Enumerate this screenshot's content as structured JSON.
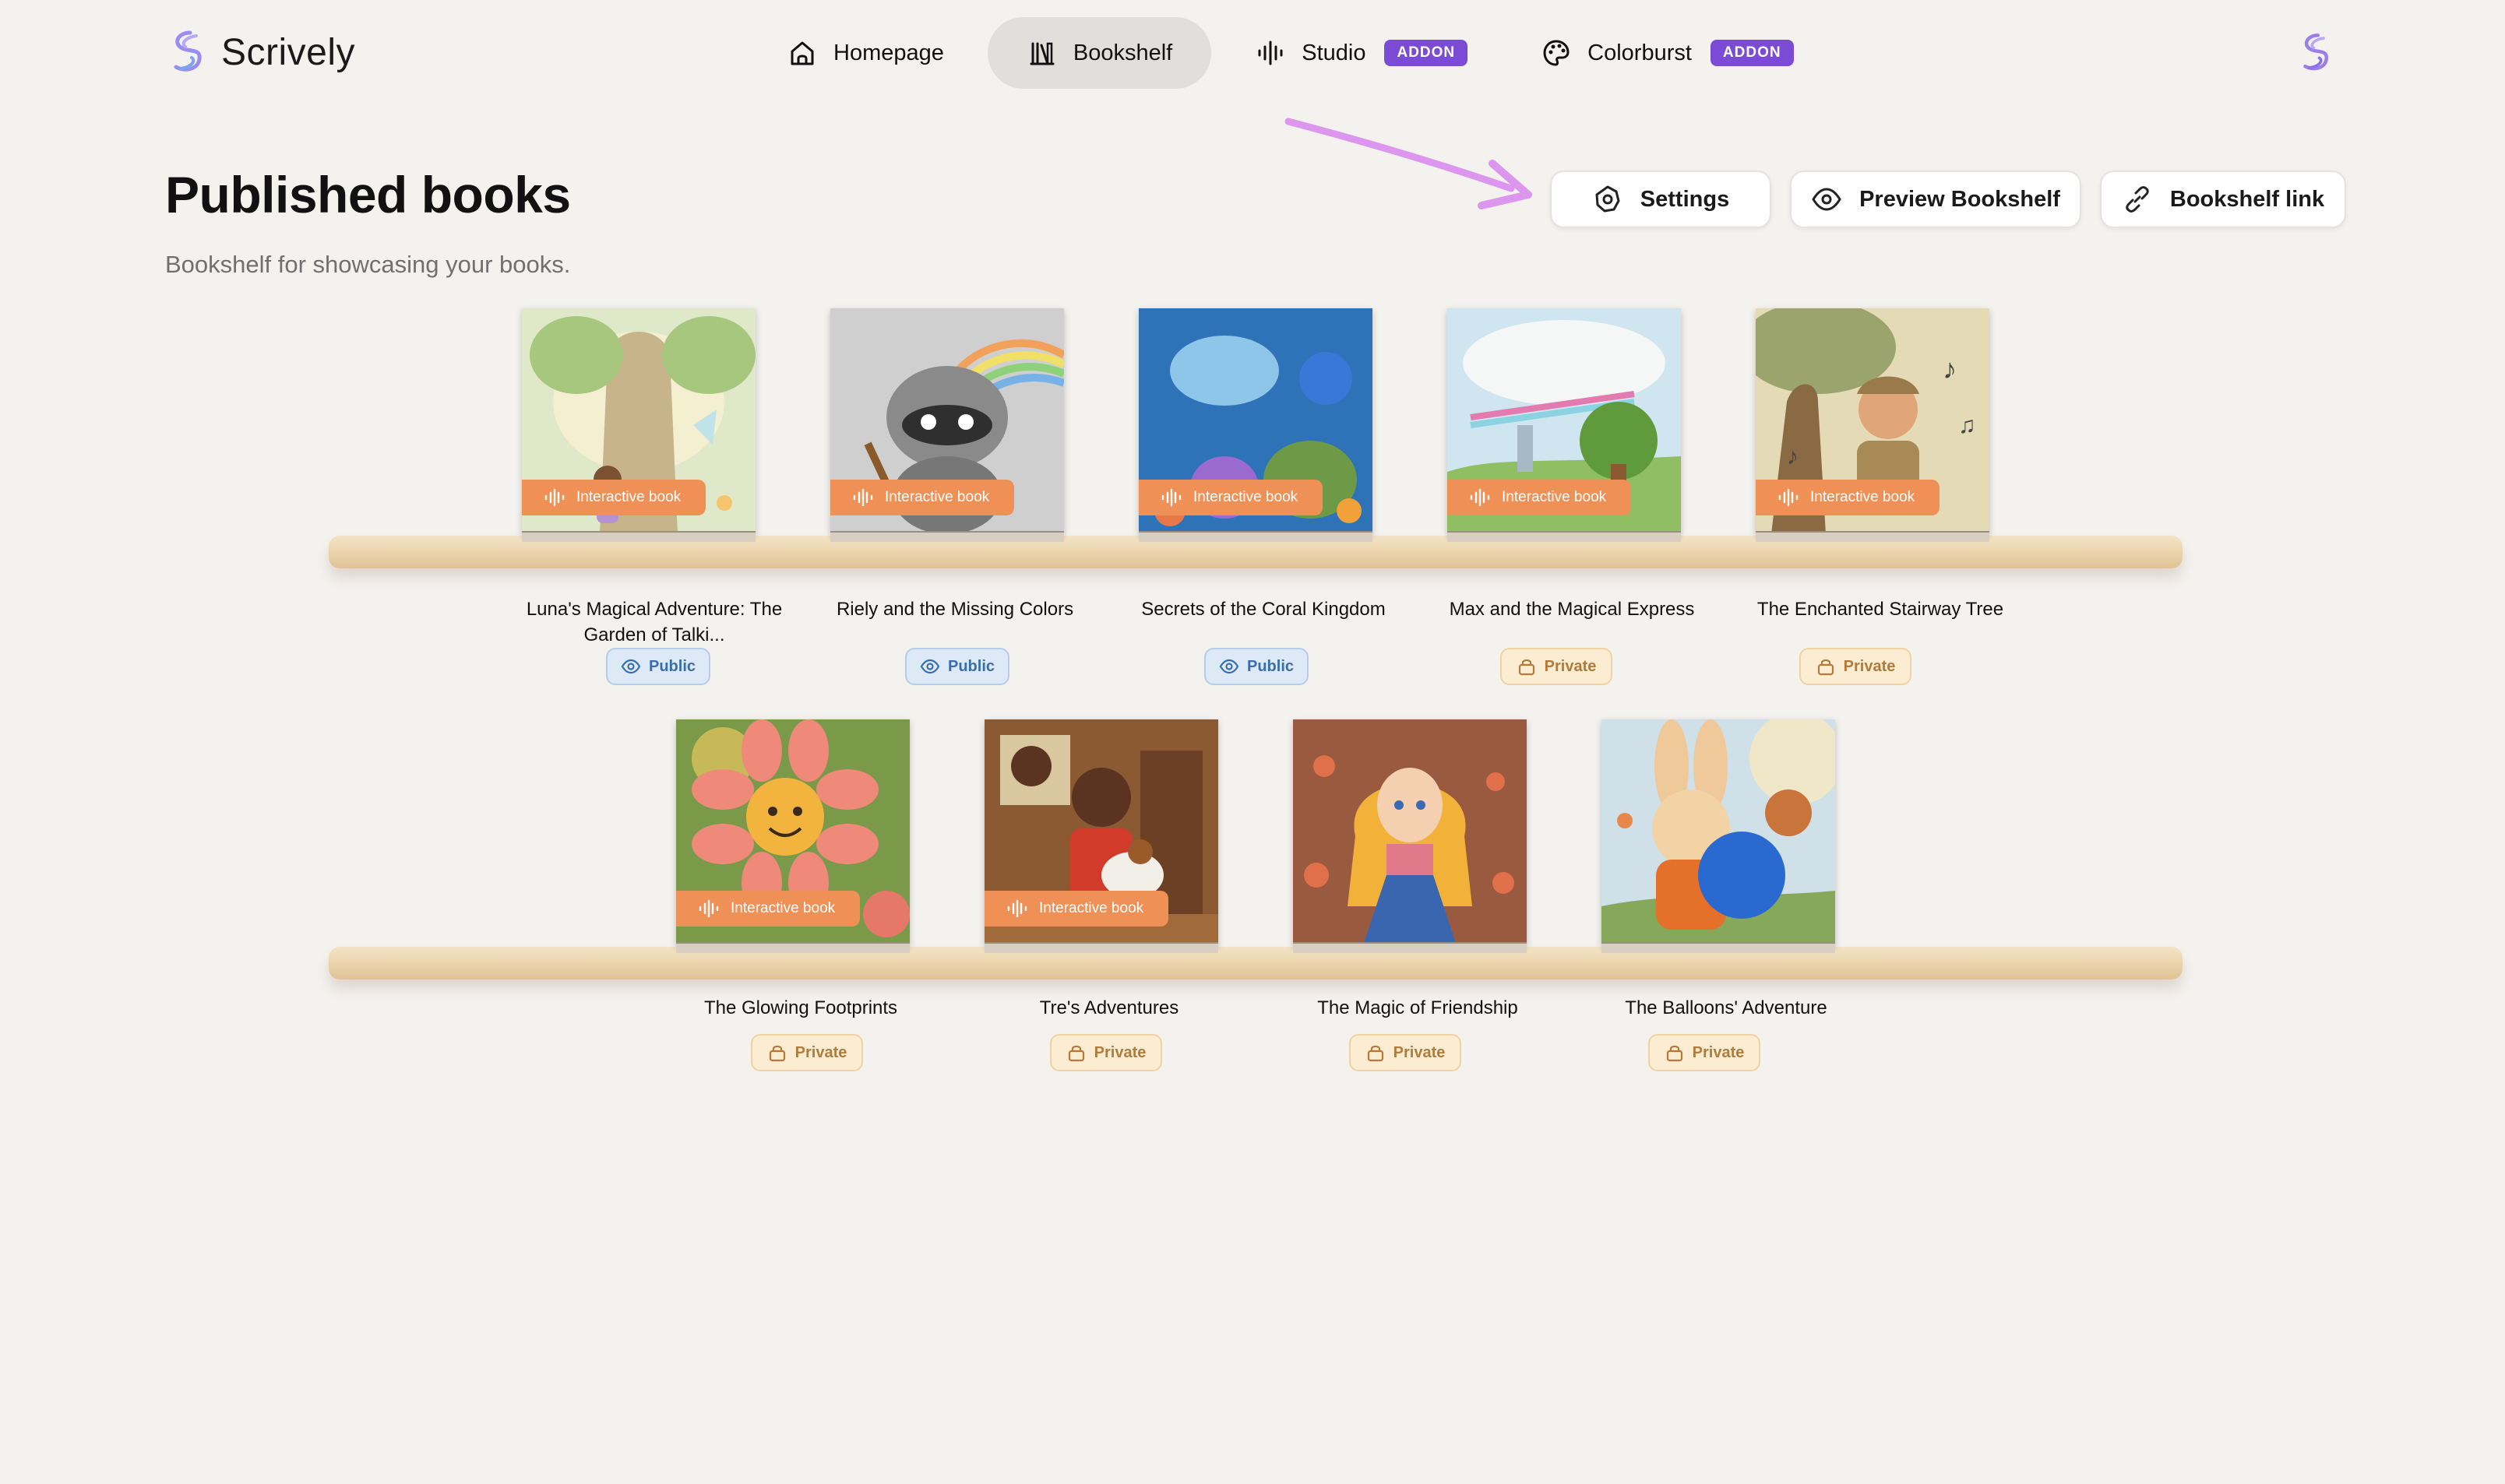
{
  "app": {
    "name": "Scrively"
  },
  "nav": {
    "items": [
      {
        "label": "Homepage"
      },
      {
        "label": "Bookshelf"
      },
      {
        "label": "Studio",
        "badge": "ADDON"
      },
      {
        "label": "Colorburst",
        "badge": "ADDON"
      }
    ],
    "active": "Bookshelf"
  },
  "page": {
    "title": "Published books",
    "subtitle": "Bookshelf for showcasing your books."
  },
  "actions": {
    "settings": "Settings",
    "preview": "Preview Bookshelf",
    "link": "Bookshelf link"
  },
  "interactive_label": "Interactive book",
  "books": [
    {
      "title": "Luna's Magical Adventure: The Garden of Talki...",
      "status": "Public",
      "interactive": true
    },
    {
      "title": "Riely and the Missing Colors",
      "status": "Public",
      "interactive": true
    },
    {
      "title": "Secrets of the Coral Kingdom",
      "status": "Public",
      "interactive": true
    },
    {
      "title": "Max and the Magical Express",
      "status": "Private",
      "interactive": true
    },
    {
      "title": "The Enchanted Stairway Tree",
      "status": "Private",
      "interactive": true
    },
    {
      "title": "The Glowing Footprints",
      "status": "Private",
      "interactive": true
    },
    {
      "title": "Tre's Adventures",
      "status": "Private",
      "interactive": true
    },
    {
      "title": "The Magic of Friendship",
      "status": "Private",
      "interactive": false
    },
    {
      "title": "The Balloons' Adventure",
      "status": "Private",
      "interactive": false
    }
  ],
  "colors": {
    "background": "#f4f2ef",
    "accent_purple": "#7b4bd6",
    "interactive_orange": "#ef9157",
    "public_blue": "#3a6ea8",
    "private_amber": "#b27b3a"
  },
  "icons": [
    "home-icon",
    "bookshelf-icon",
    "audio-wave-icon",
    "palette-icon",
    "gear-icon",
    "eye-icon",
    "link-icon",
    "lock-icon"
  ]
}
